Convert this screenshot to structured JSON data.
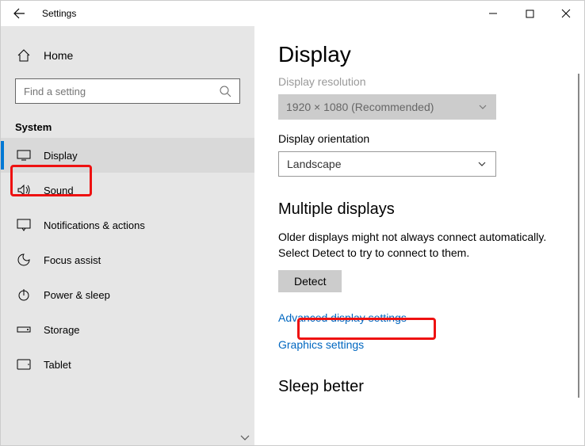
{
  "window": {
    "title": "Settings"
  },
  "sidebar": {
    "home_label": "Home",
    "search_placeholder": "Find a setting",
    "section": "System",
    "items": [
      {
        "label": "Display"
      },
      {
        "label": "Sound"
      },
      {
        "label": "Notifications & actions"
      },
      {
        "label": "Focus assist"
      },
      {
        "label": "Power & sleep"
      },
      {
        "label": "Storage"
      },
      {
        "label": "Tablet"
      }
    ]
  },
  "content": {
    "title": "Display",
    "resolution_label": "Display resolution",
    "resolution_value": "1920 × 1080 (Recommended)",
    "orientation_label": "Display orientation",
    "orientation_value": "Landscape",
    "multiple_header": "Multiple displays",
    "multiple_body": "Older displays might not always connect automatically. Select Detect to try to connect to them.",
    "detect_btn": "Detect",
    "adv_link": "Advanced display settings",
    "gfx_link": "Graphics settings",
    "sleep_header": "Sleep better"
  }
}
